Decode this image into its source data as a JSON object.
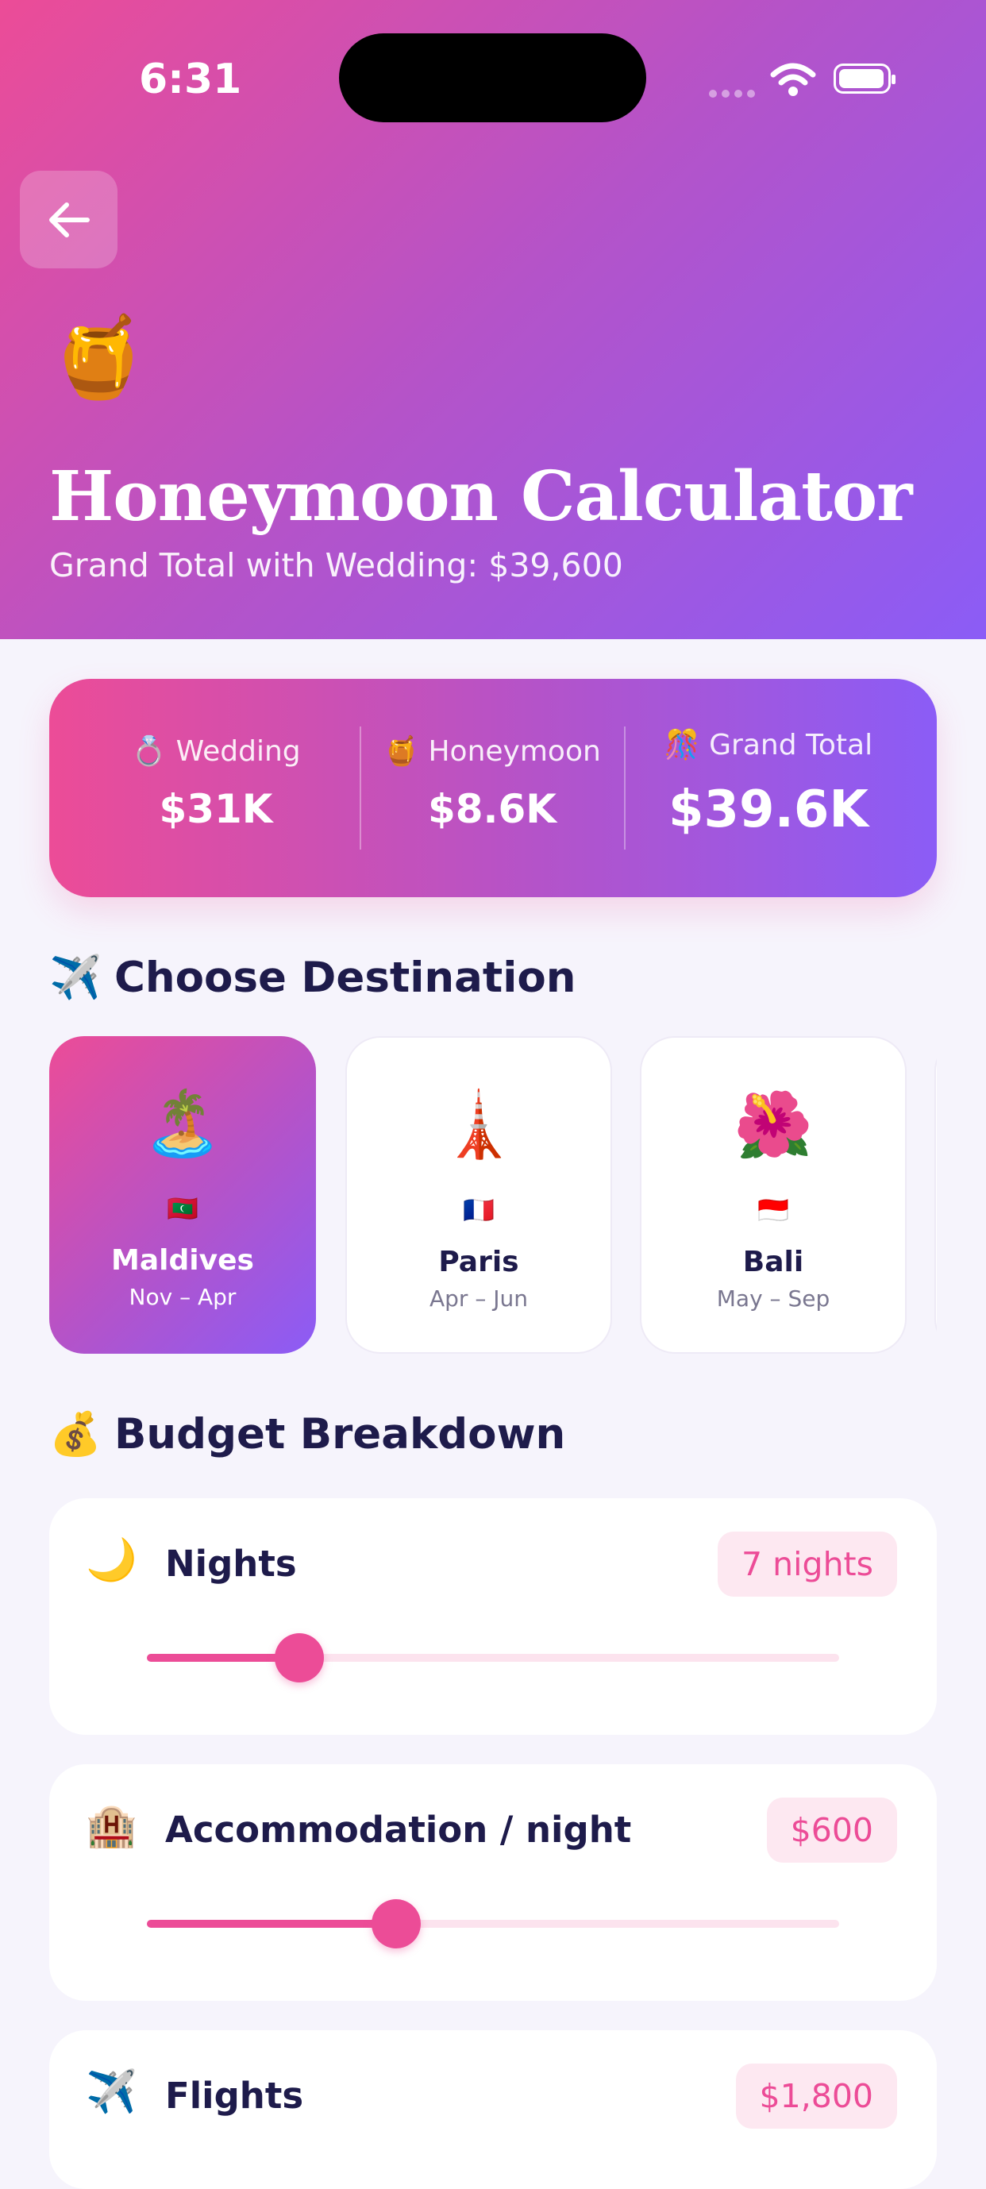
{
  "status_bar": {
    "time": "6:31"
  },
  "header": {
    "emoji": "🍯",
    "title": "Honeymoon Calculator",
    "subtitle": "Grand Total with Wedding: $39,600"
  },
  "summary": {
    "items": [
      {
        "icon": "💍",
        "label": "Wedding",
        "value": "$31K"
      },
      {
        "icon": "🍯",
        "label": "Honeymoon",
        "value": "$8.6K"
      },
      {
        "icon": "🎊",
        "label": "Grand Total",
        "value": "$39.6K"
      }
    ]
  },
  "destinations_section": {
    "icon": "✈️",
    "title": "Choose Destination",
    "items": [
      {
        "emoji": "🏝️",
        "flag": "🇲🇻",
        "name": "Maldives",
        "season": "Nov – Apr",
        "selected": true
      },
      {
        "emoji": "🗼",
        "flag": "🇫🇷",
        "name": "Paris",
        "season": "Apr – Jun",
        "selected": false
      },
      {
        "emoji": "🌺",
        "flag": "🇮🇩",
        "name": "Bali",
        "season": "May – Sep",
        "selected": false
      }
    ]
  },
  "budget_section": {
    "icon": "💰",
    "title": "Budget Breakdown",
    "items": [
      {
        "icon": "🌙",
        "label": "Nights",
        "value": "7 nights",
        "level": 0.22
      },
      {
        "icon": "🏨",
        "label": "Accommodation / night",
        "value": "$600",
        "level": 0.36
      },
      {
        "icon": "✈️",
        "label": "Flights",
        "value": "$1,800"
      }
    ]
  },
  "colors": {
    "primary_pink": "#EC4C97",
    "primary_purple": "#8B5CF6",
    "text_dark": "#1E1B4B",
    "background": "#F6F4FC"
  }
}
